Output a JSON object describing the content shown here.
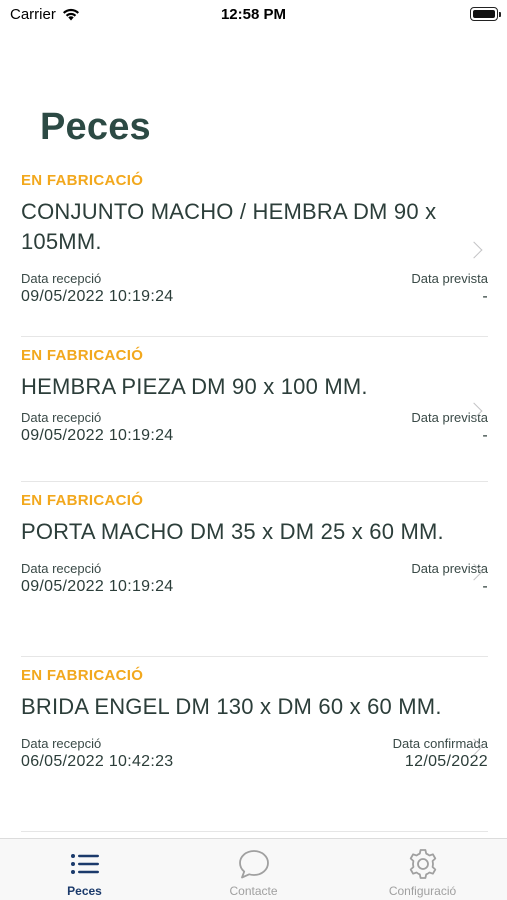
{
  "status_bar": {
    "carrier": "Carrier",
    "time": "12:58 PM"
  },
  "title": "Peces",
  "items": [
    {
      "status": "EN FABRICACIÓ",
      "name": "CONJUNTO MACHO / HEMBRA DM 90 x 105MM.",
      "left_label": "Data recepció",
      "left_value": "09/05/2022 10:19:24",
      "right_label": "Data prevista",
      "right_value": "-"
    },
    {
      "status": "EN FABRICACIÓ",
      "name": "HEMBRA PIEZA DM 90 x 100 MM.",
      "left_label": "Data recepció",
      "left_value": "09/05/2022 10:19:24",
      "right_label": "Data prevista",
      "right_value": "-"
    },
    {
      "status": "EN FABRICACIÓ",
      "name": "PORTA MACHO DM 35 x DM 25 x 60 MM.",
      "left_label": "Data recepció",
      "left_value": "09/05/2022 10:19:24",
      "right_label": "Data prevista",
      "right_value": "-"
    },
    {
      "status": "EN FABRICACIÓ",
      "name": "BRIDA ENGEL DM 130 x DM 60 x 60 MM.",
      "left_label": "Data recepció",
      "left_value": "06/05/2022 10:42:23",
      "right_label": "Data confirmada",
      "right_value": "12/05/2022"
    }
  ],
  "tabs": [
    {
      "label": "Peces",
      "icon": "list-icon",
      "active": true
    },
    {
      "label": "Contacte",
      "icon": "chat-bubble-icon",
      "active": false
    },
    {
      "label": "Configuració",
      "icon": "gear-icon",
      "active": false
    }
  ],
  "colors": {
    "status": "#f2a81d",
    "title": "#2c4a44",
    "active_tab": "#1b3a6b",
    "inactive_tab": "#a0a0a0"
  }
}
